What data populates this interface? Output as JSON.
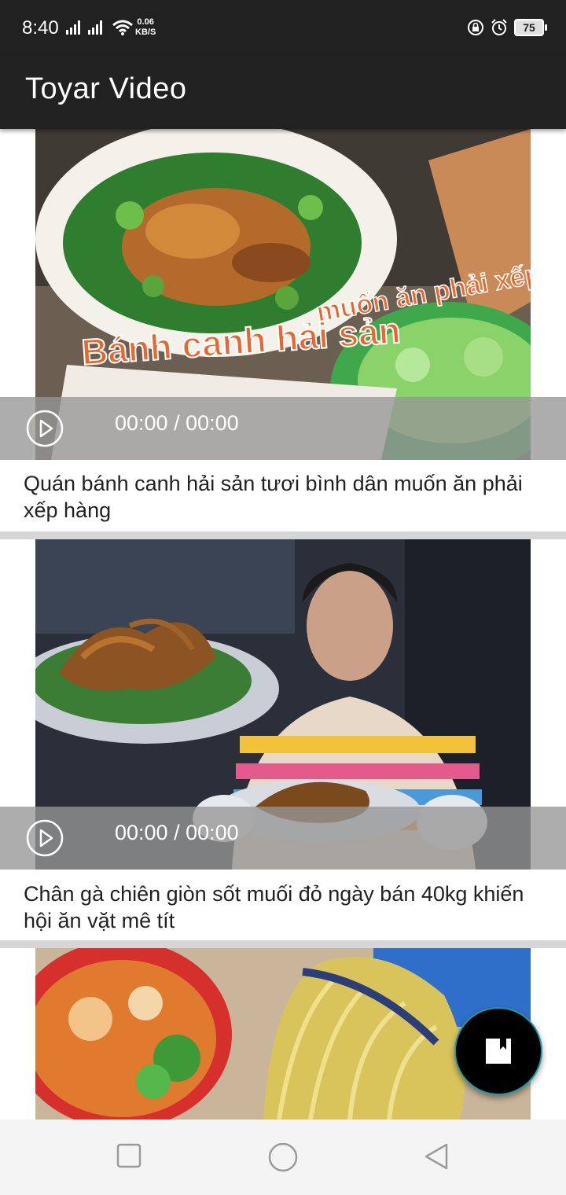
{
  "status_bar": {
    "time": "8:40",
    "net_speed_value": "0.06",
    "net_speed_unit": "KB/S",
    "battery": "75"
  },
  "app_bar": {
    "title": "Toyar Video"
  },
  "videos": [
    {
      "timecode": "00:00 / 00:00",
      "title": "Quán bánh canh hải sản tươi bình dân muốn ăn phải xếp hàng",
      "overlay_text_main": "Bánh canh hải sản",
      "overlay_text_secondary": "muốn ăn phải xếp h"
    },
    {
      "timecode": "00:00 / 00:00",
      "title": "Chân gà chiên giòn sốt muối đỏ ngày bán 40kg khiến hội ăn vặt mê tít"
    }
  ],
  "fab": {
    "icon": "bookmark-icon"
  },
  "nav_bar": {
    "icons": [
      "recents-square-icon",
      "home-circle-icon",
      "back-triangle-icon"
    ]
  }
}
